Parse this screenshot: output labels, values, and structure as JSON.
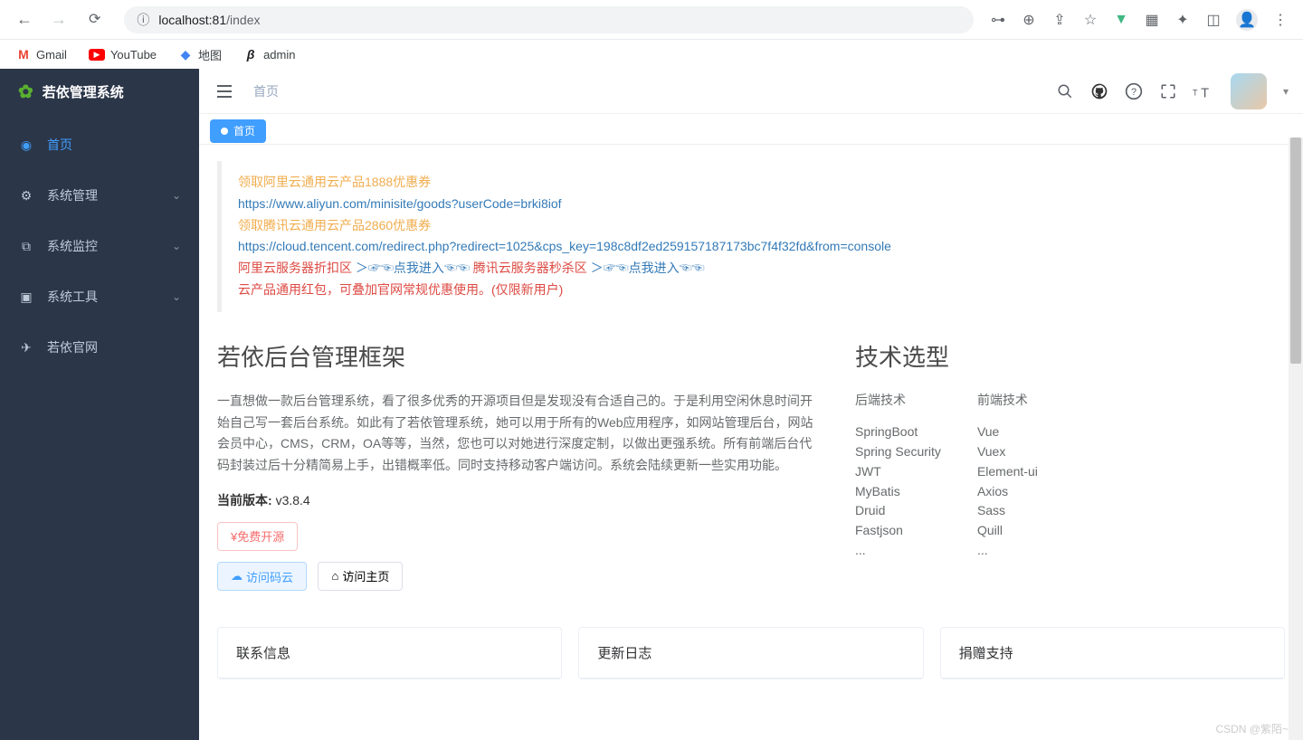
{
  "browser": {
    "url_info_icon": "ⓘ",
    "url_host": "localhost:81",
    "url_path": "/index",
    "bookmarks": [
      {
        "label": "Gmail",
        "icon_class": "gmail-icon",
        "icon_glyph": "M"
      },
      {
        "label": "YouTube",
        "icon_class": "yt-icon",
        "icon_glyph": "▶"
      },
      {
        "label": "地图",
        "icon_class": "maps-icon",
        "icon_glyph": "◆"
      },
      {
        "label": "admin",
        "icon_class": "admin-icon",
        "icon_glyph": "β"
      }
    ]
  },
  "sidebar": {
    "brand": "若依管理系统",
    "items": [
      {
        "icon": "◉",
        "label": "首页",
        "active": true,
        "arrow": false
      },
      {
        "icon": "⚙",
        "label": "系统管理",
        "active": false,
        "arrow": true
      },
      {
        "icon": "⧉",
        "label": "系统监控",
        "active": false,
        "arrow": true
      },
      {
        "icon": "▣",
        "label": "系统工具",
        "active": false,
        "arrow": true
      },
      {
        "icon": "✈",
        "label": "若依官网",
        "active": false,
        "arrow": false
      }
    ]
  },
  "topbar": {
    "breadcrumb": "首页",
    "active_tab": "首页"
  },
  "callout": {
    "line1_orange": "领取阿里云通用云产品1888优惠券",
    "link1": "https://www.aliyun.com/minisite/goods?userCode=brki8iof",
    "line2_orange": "领取腾讯云通用云产品2860优惠券",
    "link2": "https://cloud.tencent.com/redirect.php?redirect=1025&cps_key=198c8df2ed259157187173bc7f4f32fd&from=console",
    "red1": "阿里云服务器折扣区",
    "blue1": "＞☞☜点我进入☜☜",
    "red2": " 腾讯云服务器秒杀区",
    "blue2": "＞☞☜点我进入☜☜",
    "red3": "云产品通用红包，可叠加官网常规优惠使用。(仅限新用户)"
  },
  "main": {
    "title": "若依后台管理框架",
    "description": "一直想做一款后台管理系统，看了很多优秀的开源项目但是发现没有合适自己的。于是利用空闲休息时间开始自己写一套后台系统。如此有了若依管理系统，她可以用于所有的Web应用程序，如网站管理后台，网站会员中心，CMS，CRM，OA等等，当然，您也可以对她进行深度定制，以做出更强系统。所有前端后台代码封装过后十分精简易上手，出错概率低。同时支持移动客户端访问。系统会陆续更新一些实用功能。",
    "version_label": "当前版本:",
    "version_value": "v3.8.4",
    "btn_free": "¥免费开源",
    "btn_gitee": "访问码云",
    "btn_home": "访问主页"
  },
  "tech": {
    "title": "技术选型",
    "backend_title": "后端技术",
    "frontend_title": "前端技术",
    "backend": [
      "SpringBoot",
      "Spring Security",
      "JWT",
      "MyBatis",
      "Druid",
      "Fastjson",
      "..."
    ],
    "frontend": [
      "Vue",
      "Vuex",
      "Element-ui",
      "Axios",
      "Sass",
      "Quill",
      "..."
    ]
  },
  "panels": {
    "contact": "联系信息",
    "changelog": "更新日志",
    "donate": "捐赠支持"
  },
  "watermark": "CSDN @紫陌~"
}
